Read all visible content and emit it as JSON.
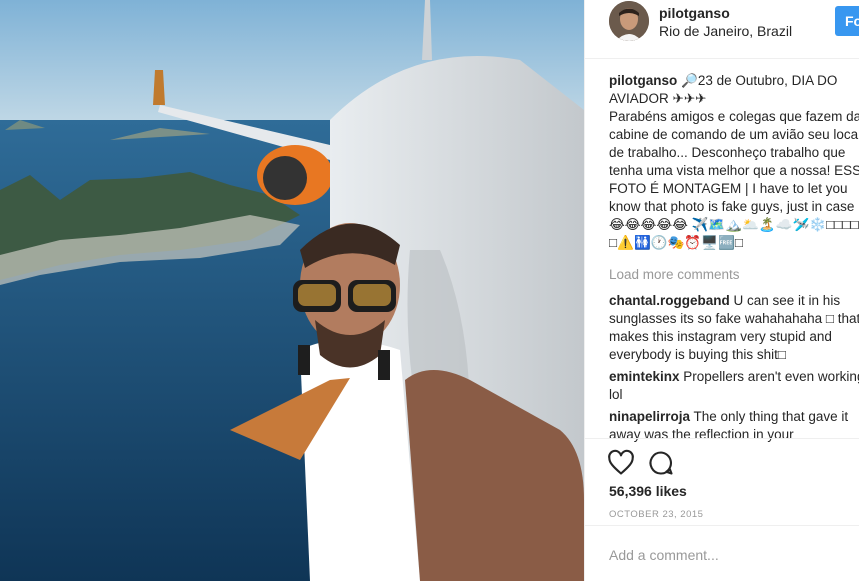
{
  "post": {
    "username": "pilotganso",
    "location": "Rio de Janeiro, Brazil",
    "follow_label": "Fo",
    "caption_lines": [
      "🔎23 de Outubro, DIA DO",
      "AVIADOR ✈✈✈",
      "Parabéns amigos e colegas que fazem da",
      "cabine de comando de um avião seu local",
      "de trabalho... Desconheço trabalho que",
      "tenha uma vista melhor que a nossa! ESSA",
      "FOTO É MONTAGEM | I have to let you",
      "know that photo is fake guys, just in case",
      "😂😂😂😂😂 ✈️🗺️🏔️🌥️🏝️☁️🛩️❄️□□□□□□",
      "□⚠️🚻🕐🎭⏰🖥️🆓□"
    ],
    "load_more": "Load more comments",
    "comments": [
      {
        "user": "chantal.roggeband",
        "lines": [
          " U can see it in his",
          "sunglasses its so fake wahahahaha □ that",
          "makes this instagram very stupid and",
          "everybody is buying this shit□"
        ]
      },
      {
        "user": "emintekinx",
        "lines": [
          " Propellers aren't even working",
          "lol"
        ]
      },
      {
        "user": "ninapelirroja",
        "lines": [
          " The only thing that gave it",
          "away was the reflection in your"
        ]
      }
    ],
    "likes": "56,396 likes",
    "date": "OCTOBER 23, 2015",
    "add_comment_placeholder": "Add a comment..."
  },
  "icons": {
    "like": "heart-icon",
    "comment": "comment-bubble-icon"
  },
  "colors": {
    "follow_button": "#3897f0",
    "muted_text": "#999999",
    "text": "#262626"
  }
}
